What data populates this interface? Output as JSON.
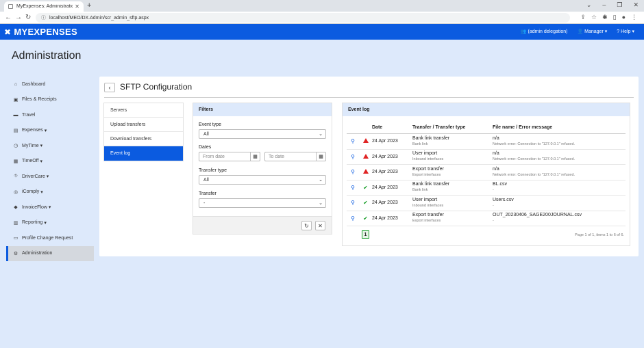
{
  "browser": {
    "tab_title": "MyExpenses: Administration - SF",
    "url": "localhost/MEO/DX.Admin/scr_admin_sftp.aspx"
  },
  "header": {
    "brand": "MYEXPENSES",
    "delegation": "(admin delegation)",
    "manager": "Manager",
    "help": "Help"
  },
  "page_title": "Administration",
  "sidebar": {
    "items": [
      {
        "label": "Dashboard",
        "icon": "home-icon"
      },
      {
        "label": "Files & Receipts",
        "icon": "image-icon"
      },
      {
        "label": "Travel",
        "icon": "car-icon"
      },
      {
        "label": "Expenses",
        "icon": "receipt-icon"
      },
      {
        "label": "MyTime",
        "icon": "clock-icon"
      },
      {
        "label": "TimeOff",
        "icon": "calendar-icon"
      },
      {
        "label": "DriverCare",
        "icon": "road-icon"
      },
      {
        "label": "iComply",
        "icon": "comply-icon"
      },
      {
        "label": "InvoiceFlow",
        "icon": "invoice-icon"
      },
      {
        "label": "Reporting",
        "icon": "report-icon"
      },
      {
        "label": "Profile Change Request",
        "icon": "profile-icon"
      },
      {
        "label": "Administration",
        "icon": "gears-icon"
      }
    ]
  },
  "card": {
    "title": "SFTP Configuration"
  },
  "subnav": {
    "items": [
      "Servers",
      "Upload transfers",
      "Download transfers",
      "Event log"
    ]
  },
  "filters": {
    "title": "Filters",
    "event_type_label": "Event type",
    "event_type_value": "All",
    "dates_label": "Dates",
    "from_placeholder": "From date",
    "to_placeholder": "To date",
    "transfer_type_label": "Transfer type",
    "transfer_type_value": "All",
    "transfer_label": "Transfer",
    "transfer_value": "-"
  },
  "eventlog": {
    "title": "Event log",
    "columns": {
      "date": "Date",
      "transfer": "Transfer / Transfer type",
      "file": "File name / Error message"
    },
    "rows": [
      {
        "status": "error",
        "date": "24 Apr 2023",
        "transfer": "Bank link transfer",
        "type": "Bank link",
        "file": "n/a",
        "message": "Network error: Connection to \"127.0.0.1\" refused."
      },
      {
        "status": "error",
        "date": "24 Apr 2023",
        "transfer": "User import",
        "type": "Inbound interfaces",
        "file": "n/a",
        "message": "Network error: Connection to \"127.0.0.1\" refused."
      },
      {
        "status": "error",
        "date": "24 Apr 2023",
        "transfer": "Export transfer",
        "type": "Export interfaces",
        "file": "n/a",
        "message": "Network error: Connection to \"127.0.0.1\" refused."
      },
      {
        "status": "ok",
        "date": "24 Apr 2023",
        "transfer": "Bank link transfer",
        "type": "Bank link",
        "file": "BL.csv",
        "message": "-"
      },
      {
        "status": "ok",
        "date": "24 Apr 2023",
        "transfer": "User import",
        "type": "Inbound interfaces",
        "file": "Users.csv",
        "message": "-"
      },
      {
        "status": "ok",
        "date": "24 Apr 2023",
        "transfer": "Export transfer",
        "type": "Export interfaces",
        "file": "OUT_20230406_SAGE200JOURNAL.csv",
        "message": "-"
      }
    ],
    "page": "1",
    "page_info": "Page 1 of 1, items 1 to 6 of 6."
  }
}
